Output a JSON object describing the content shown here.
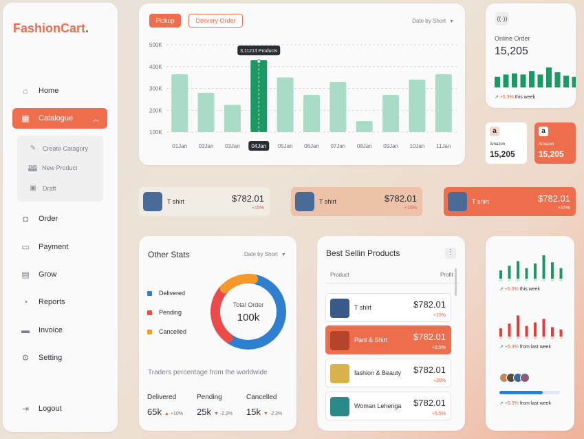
{
  "brand": {
    "name": "FashionCart",
    "dot": "."
  },
  "sidebar": {
    "items": [
      {
        "label": "Home",
        "icon": "home-icon"
      },
      {
        "label": "Catalogue",
        "icon": "grid-icon",
        "active": true
      },
      {
        "label": "Order",
        "icon": "bag-icon"
      },
      {
        "label": "Payment",
        "icon": "wallet-icon"
      },
      {
        "label": "Grow",
        "icon": "box-icon"
      },
      {
        "label": "Reports",
        "icon": "pie-icon"
      },
      {
        "label": "Invoice",
        "icon": "document-icon"
      },
      {
        "label": "Setting",
        "icon": "gear-icon"
      }
    ],
    "sub_items": [
      {
        "label": "Create Catagory",
        "icon": "pencil-icon"
      },
      {
        "label": "New Product",
        "icon": "new-badge-icon",
        "badge": "NEW"
      },
      {
        "label": "Draft",
        "icon": "save-icon"
      }
    ],
    "logout": "Logout"
  },
  "chart_card": {
    "btn_pickup": "Pickup",
    "btn_delivery": "Delivery Order",
    "dropdown": "Date by Short",
    "tooltip": "3,11213 Products",
    "highlight_index": 3,
    "colors": {
      "bar": "#a8dcc6",
      "active": "#1a9a62"
    }
  },
  "chart_data": {
    "type": "bar",
    "categories": [
      "01Jan",
      "02Jan",
      "03Jan",
      "04Jan",
      "05Jan",
      "06Jan",
      "07Jan",
      "08Jan",
      "09Jan",
      "10Jan",
      "11Jan"
    ],
    "values": [
      365,
      280,
      225,
      430,
      350,
      270,
      330,
      150,
      270,
      340,
      365
    ],
    "units": "K",
    "yticks": [
      "500K",
      "400K",
      "300K",
      "200K",
      "100K"
    ],
    "ylim": [
      100,
      500
    ],
    "grid": true
  },
  "online_order": {
    "label": "Online Order",
    "value": "15,205",
    "change": "+5.3%",
    "period": "this week",
    "bars": [
      0.45,
      0.55,
      0.6,
      0.55,
      0.7,
      0.55,
      0.85,
      0.65,
      0.5,
      0.45
    ]
  },
  "amazon": [
    {
      "name": "Amazon",
      "value": "15,205"
    },
    {
      "name": "Amazon",
      "value": "15,205"
    }
  ],
  "strips": [
    {
      "name": "T shirt",
      "price": "$782.01",
      "change": "+15%"
    },
    {
      "name": "T shirt",
      "price": "$782.01",
      "change": "+15%"
    },
    {
      "name": "T shirt",
      "price": "$782.01",
      "change": "+15%"
    }
  ],
  "other_stats": {
    "title": "Other Stats",
    "dropdown": "Date by Short",
    "legend": [
      {
        "label": "Delivered",
        "color": "#2e7fd0"
      },
      {
        "label": "Pending",
        "color": "#ea4a4a"
      },
      {
        "label": "Cancelled",
        "color": "#f39a2b"
      }
    ],
    "donut_label": "Total Order",
    "donut_value": "100k",
    "donut_shares": [
      0.58,
      0.27,
      0.15
    ],
    "traders": "Traders percentage from the worldwide",
    "cols": [
      {
        "label": "Delivered",
        "value": "65k",
        "arrow": "▲",
        "change": "+10%"
      },
      {
        "label": "Pending",
        "value": "25k",
        "arrow": "▼",
        "change": "-2.3%"
      },
      {
        "label": "Cancelled",
        "value": "15k",
        "arrow": "▼",
        "change": "-2.3%"
      }
    ]
  },
  "best_selling": {
    "title": "Best Sellin Products",
    "col_product": "Product",
    "col_profit": "Profit",
    "rows": [
      {
        "name": "T shirt",
        "price": "$782.01",
        "change": "+15%",
        "color": "#3a5a8a"
      },
      {
        "name": "Pant & Shirt",
        "price": "$782.01",
        "change": "+2.5%",
        "color": "#b4452a",
        "highlight": true
      },
      {
        "name": "fashion & Beauty",
        "price": "$782.01",
        "change": "+20%",
        "color": "#d8b24a"
      },
      {
        "name": "Woman Lehenga",
        "price": "$782.01",
        "change": "+5.5%",
        "color": "#2a8a8a"
      }
    ]
  },
  "right_stats": {
    "green": {
      "change": "+5.3%",
      "period": "this week",
      "bars": [
        0.35,
        0.55,
        0.75,
        0.45,
        0.65,
        1,
        0.7,
        0.45
      ]
    },
    "red": {
      "change": "+5.3%",
      "period": "from last week",
      "bars": [
        0.35,
        0.55,
        0.9,
        0.45,
        0.6,
        0.75,
        0.4,
        0.3
      ]
    },
    "blue": {
      "change": "+5.3%",
      "period": "from last week",
      "progress": 0.72
    }
  }
}
